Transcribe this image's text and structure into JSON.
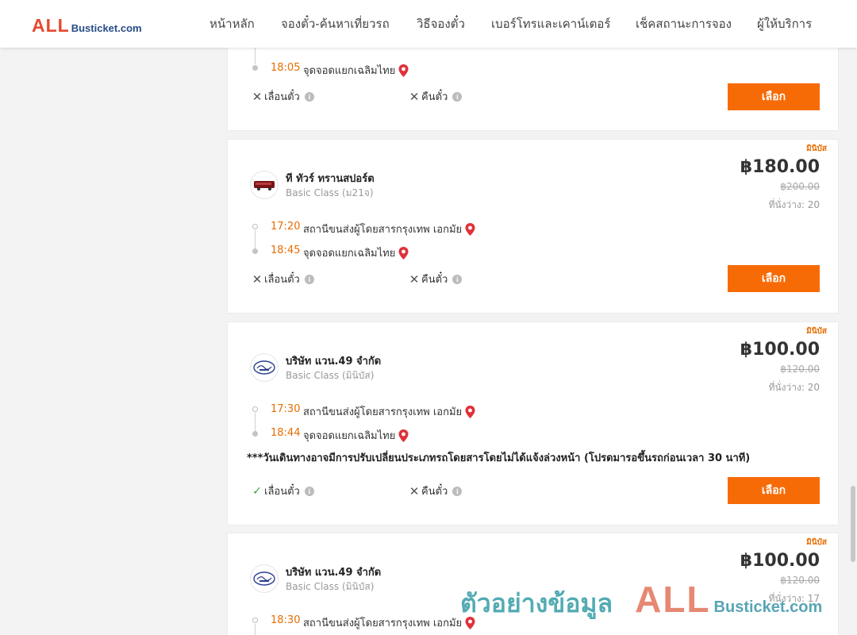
{
  "brand": {
    "all": "ALL",
    "bus": "Busticket.com"
  },
  "nav": [
    "หน้าหลัก",
    "จองตั๋ว-ค้นหาเที่ยวรถ",
    "วิธีจองตั๋ว",
    "เบอร์โทรและเคาน์เตอร์",
    "เช็คสถานะการจอง",
    "ผู้ให้บริการ"
  ],
  "cards": [
    {
      "arrive_time": "18:05",
      "arrive_place": "จุดจอดแยกเฉลิมไทย",
      "policy_change": "เลื่อนตั๋ว",
      "policy_refund": "คืนตั๋ว",
      "button": "เลือก"
    },
    {
      "tag": "มินิบัส",
      "operator": "ที ทัวร์ ทรานสปอร์ต",
      "bus_class": "Basic Class (ม21จ)",
      "price": "฿180.00",
      "old_price": "฿200.00",
      "seats": "ที่นั่งว่าง: 20",
      "depart_time": "17:20",
      "depart_place": "สถานีขนส่งผู้โดยสารกรุงเทพ เอกมัย",
      "arrive_time": "18:45",
      "arrive_place": "จุดจอดแยกเฉลิมไทย",
      "policy_change": "เลื่อนตั๋ว",
      "policy_refund": "คืนตั๋ว",
      "button": "เลือก"
    },
    {
      "tag": "มินิบัส",
      "operator": "บริษัท แวน.49 จำกัด",
      "bus_class": "Basic Class (มินิบัส)",
      "price": "฿100.00",
      "old_price": "฿120.00",
      "seats": "ที่นั่งว่าง: 20",
      "depart_time": "17:30",
      "depart_place": "สถานีขนส่งผู้โดยสารกรุงเทพ เอกมัย",
      "arrive_time": "18:44",
      "arrive_place": "จุดจอดแยกเฉลิมไทย",
      "notice": "***วันเดินทางอาจมีการปรับเปลี่ยนประเภทรถโดยสารโดยไม่ได้แจ้งล่วงหน้า (โปรดมารอขึ้นรถก่อนเวลา 30 นาที)",
      "policy_change": "เลื่อนตั๋ว",
      "policy_refund": "คืนตั๋ว",
      "button": "เลือก"
    },
    {
      "tag": "มินิบัส",
      "operator": "บริษัท แวน.49 จำกัด",
      "bus_class": "Basic Class (มินิบัส)",
      "price": "฿100.00",
      "old_price": "฿120.00",
      "seats": "ที่นั่งว่าง: 17",
      "depart_time": "18:30",
      "depart_place": "สถานีขนส่งผู้โดยสารกรุงเทพ เอกมัย"
    }
  ],
  "watermark": {
    "text": "ตัวอย่างข้อมูล",
    "all": "ALL",
    "bus": "Busticket.com"
  },
  "colors": {
    "accent": "#f76b07",
    "time": "#e86d00",
    "pin": "#e0313a",
    "brand_red": "#e64a2e",
    "brand_blue": "#264c86"
  },
  "icons": {
    "pin": "map-pin-icon",
    "cross": "cross-icon",
    "check": "check-icon",
    "info": "info-icon"
  }
}
